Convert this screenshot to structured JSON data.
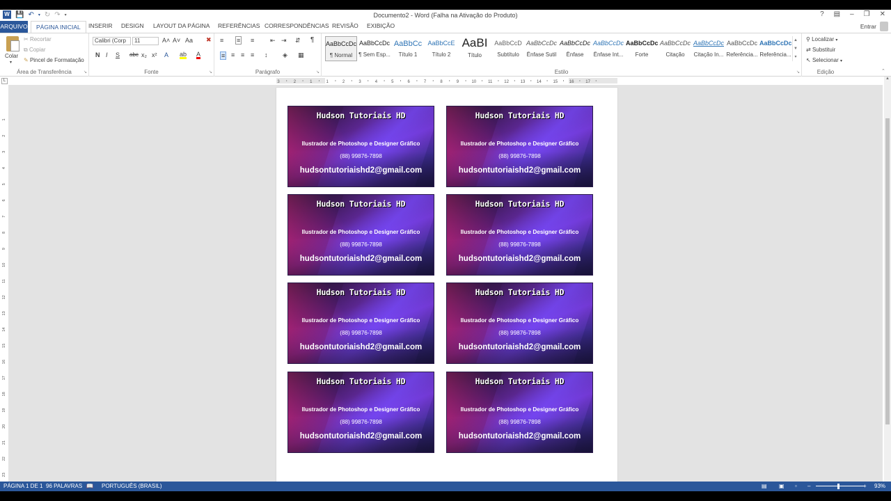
{
  "window": {
    "title": "Documento2 - Word (Falha na Ativação do Produto)",
    "help": "?",
    "signin": "Entrar"
  },
  "tabs": [
    "ARQUIVO",
    "PÁGINA INICIAL",
    "INSERIR",
    "DESIGN",
    "LAYOUT DA PÁGINA",
    "REFERÊNCIAS",
    "CORRESPONDÊNCIAS",
    "REVISÃO",
    "EXIBIÇÃO"
  ],
  "clipboard": {
    "paste": "Colar",
    "cut": "Recortar",
    "copy": "Copiar",
    "format_painter": "Pincel de Formatação",
    "label": "Área de Transferência"
  },
  "font": {
    "name": "Calibri (Corp",
    "size": "11",
    "label": "Fonte",
    "grow": "A˄",
    "shrink": "A˅",
    "case": "Aa",
    "bold": "N",
    "italic": "I",
    "underline": "S",
    "strike": "abc",
    "sub": "x₂",
    "sup": "x²",
    "effects": "A",
    "highlight": "ab",
    "color": "A"
  },
  "paragraph": {
    "label": "Parágrafo",
    "pilcrow": "¶"
  },
  "styles": {
    "label": "Estilo",
    "items": [
      {
        "sample": "AaBbCcDc",
        "name": "¶ Normal"
      },
      {
        "sample": "AaBbCcDc",
        "name": "¶ Sem Esp..."
      },
      {
        "sample": "AaBbCc",
        "name": "Título 1"
      },
      {
        "sample": "AaBbCcE",
        "name": "Título 2"
      },
      {
        "sample": "AaBI",
        "name": "Título"
      },
      {
        "sample": "AaBbCcD",
        "name": "Subtítulo"
      },
      {
        "sample": "AaBbCcDc",
        "name": "Ênfase Sutil"
      },
      {
        "sample": "AaBbCcDc",
        "name": "Ênfase"
      },
      {
        "sample": "AaBbCcDc",
        "name": "Ênfase Int..."
      },
      {
        "sample": "AaBbCcDc",
        "name": "Forte"
      },
      {
        "sample": "AaBbCcDc",
        "name": "Citação"
      },
      {
        "sample": "AaBbCcDc",
        "name": "Citação In..."
      },
      {
        "sample": "AaBbCcDc",
        "name": "Referência..."
      },
      {
        "sample": "AaBbCcDc",
        "name": "Referência..."
      }
    ]
  },
  "editing": {
    "find": "Localizar",
    "replace": "Substituir",
    "select": "Selecionar",
    "label": "Edição"
  },
  "ruler": {
    "h_numbers": [
      "3",
      "2",
      "1",
      "1",
      "2",
      "3",
      "4",
      "5",
      "6",
      "7",
      "8",
      "9",
      "10",
      "11",
      "12",
      "13",
      "14",
      "15",
      "16",
      "17"
    ],
    "v_numbers": [
      "1",
      "2",
      "3",
      "4",
      "5",
      "6",
      "7",
      "8",
      "9",
      "10",
      "11",
      "12",
      "13",
      "14",
      "15",
      "16",
      "17",
      "18",
      "19",
      "20",
      "21",
      "22",
      "23"
    ]
  },
  "card": {
    "title": "Hudson Tutoriais HD",
    "subtitle": "Ilustrador de Photoshop e Designer Gráfico",
    "phone": "(88) 99876-7898",
    "email": "hudsontutoriaishd2@gmail.com",
    "count": 8
  },
  "status": {
    "page": "PÁGINA 1 DE 1",
    "words": "96 PALAVRAS",
    "language": "PORTUGUÊS (BRASIL)",
    "zoom": "93%",
    "zoom_percent": 93
  },
  "colors": {
    "accent": "#2b579a"
  }
}
